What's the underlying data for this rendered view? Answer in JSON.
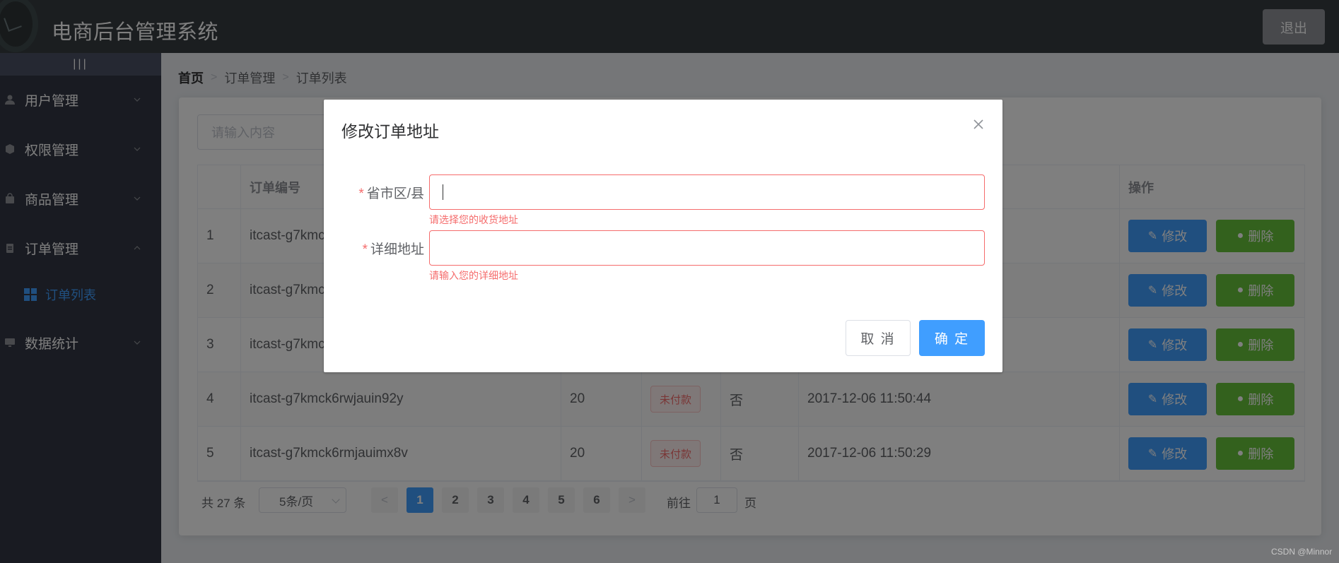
{
  "header": {
    "app_title": "电商后台管理系统",
    "logout_label": "退出"
  },
  "sidebar": {
    "toggle_label": "|||",
    "items": [
      {
        "label": "用户管理",
        "icon": "user-icon"
      },
      {
        "label": "权限管理",
        "icon": "box-icon"
      },
      {
        "label": "商品管理",
        "icon": "shopping-bag-icon"
      },
      {
        "label": "订单管理",
        "icon": "clipboard-icon",
        "expanded": true
      },
      {
        "label": "数据统计",
        "icon": "monitor-icon"
      }
    ],
    "sub_items": [
      {
        "label": "订单列表",
        "icon": "grid-icon",
        "active": true
      }
    ]
  },
  "breadcrumb": {
    "home": "首页",
    "level1": "订单管理",
    "level2": "订单列表"
  },
  "search": {
    "placeholder": "请输入内容"
  },
  "table": {
    "headers": {
      "order_no": "订单编号",
      "actions": "操作"
    },
    "rows": [
      {
        "index": "1",
        "order_no": "itcast-g7kmc",
        "price": "",
        "status": "",
        "shipped": "",
        "time": "",
        "edit": "修改",
        "delete": "删除"
      },
      {
        "index": "2",
        "order_no": "itcast-g7kmc",
        "price": "",
        "status": "",
        "shipped": "",
        "time": "",
        "edit": "修改",
        "delete": "删除"
      },
      {
        "index": "3",
        "order_no": "itcast-g7kmc",
        "price": "",
        "status": "",
        "shipped": "",
        "time": "",
        "edit": "修改",
        "delete": "删除"
      },
      {
        "index": "4",
        "order_no": "itcast-g7kmck6rwjauin92y",
        "price": "20",
        "status": "未付款",
        "shipped": "否",
        "time": "2017-12-06 11:50:44",
        "edit": "修改",
        "delete": "删除"
      },
      {
        "index": "5",
        "order_no": "itcast-g7kmck6rmjauimx8v",
        "price": "20",
        "status": "未付款",
        "shipped": "否",
        "time": "2017-12-06 11:50:29",
        "edit": "修改",
        "delete": "删除"
      }
    ]
  },
  "pagination": {
    "total": "共 27 条",
    "page_size": "5条/页",
    "pages": [
      "1",
      "2",
      "3",
      "4",
      "5",
      "6"
    ],
    "current": "1",
    "prev": "<",
    "next": ">",
    "goto_prefix": "前往",
    "goto_value": "1",
    "goto_suffix": "页"
  },
  "dialog": {
    "title": "修改订单地址",
    "fields": [
      {
        "label": "省市区/县",
        "value": "",
        "error": "请选择您的收货地址"
      },
      {
        "label": "详细地址",
        "value": "",
        "error": "请输入您的详细地址"
      }
    ],
    "cancel_label": "取 消",
    "confirm_label": "确 定"
  },
  "watermark": "CSDN @Minnor",
  "colors": {
    "primary": "#409eff",
    "success": "#67c23a",
    "danger": "#f56c6c",
    "header_bg": "#373d41",
    "sidebar_bg": "#333744"
  }
}
